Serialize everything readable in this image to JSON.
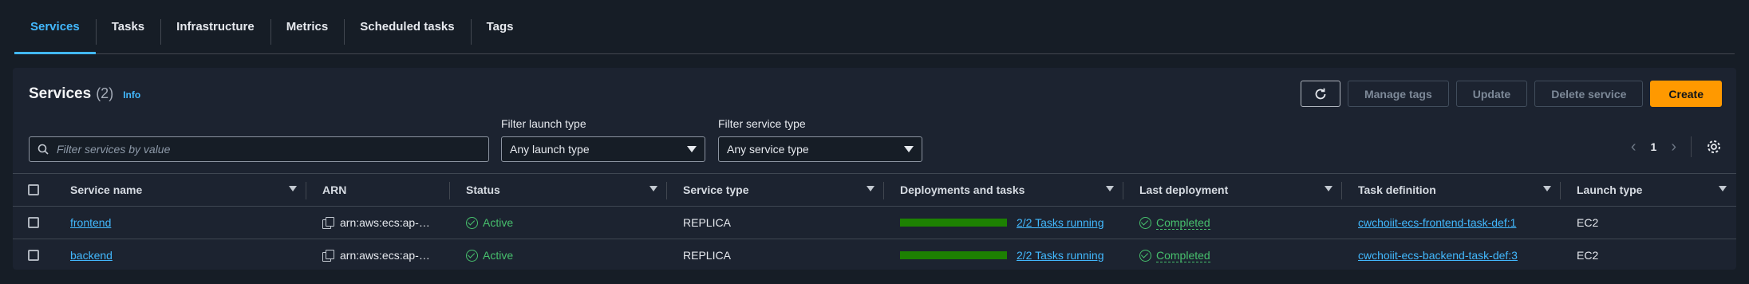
{
  "tabs": [
    "Services",
    "Tasks",
    "Infrastructure",
    "Metrics",
    "Scheduled tasks",
    "Tags"
  ],
  "panel": {
    "title": "Services",
    "count": "(2)",
    "info": "Info",
    "buttons": {
      "manage_tags": "Manage tags",
      "update": "Update",
      "delete": "Delete service",
      "create": "Create"
    },
    "search_placeholder": "Filter services by value",
    "filter_launch_label": "Filter launch type",
    "filter_launch_value": "Any launch type",
    "filter_service_label": "Filter service type",
    "filter_service_value": "Any service type",
    "page": "1"
  },
  "columns": [
    "Service name",
    "ARN",
    "Status",
    "Service type",
    "Deployments and tasks",
    "Last deployment",
    "Task definition",
    "Launch type"
  ],
  "rows": [
    {
      "name": "frontend",
      "arn": "arn:aws:ecs:ap-…",
      "status": "Active",
      "service_type": "REPLICA",
      "deploy_progress": 1.0,
      "tasks": "2/2 Tasks running",
      "last_deployment": "Completed",
      "task_def": "cwchoiit-ecs-frontend-task-def:1",
      "launch_type": "EC2"
    },
    {
      "name": "backend",
      "arn": "arn:aws:ecs:ap-…",
      "status": "Active",
      "service_type": "REPLICA",
      "deploy_progress": 1.0,
      "tasks": "2/2 Tasks running",
      "last_deployment": "Completed",
      "task_def": "cwchoiit-ecs-backend-task-def:3",
      "launch_type": "EC2"
    }
  ]
}
